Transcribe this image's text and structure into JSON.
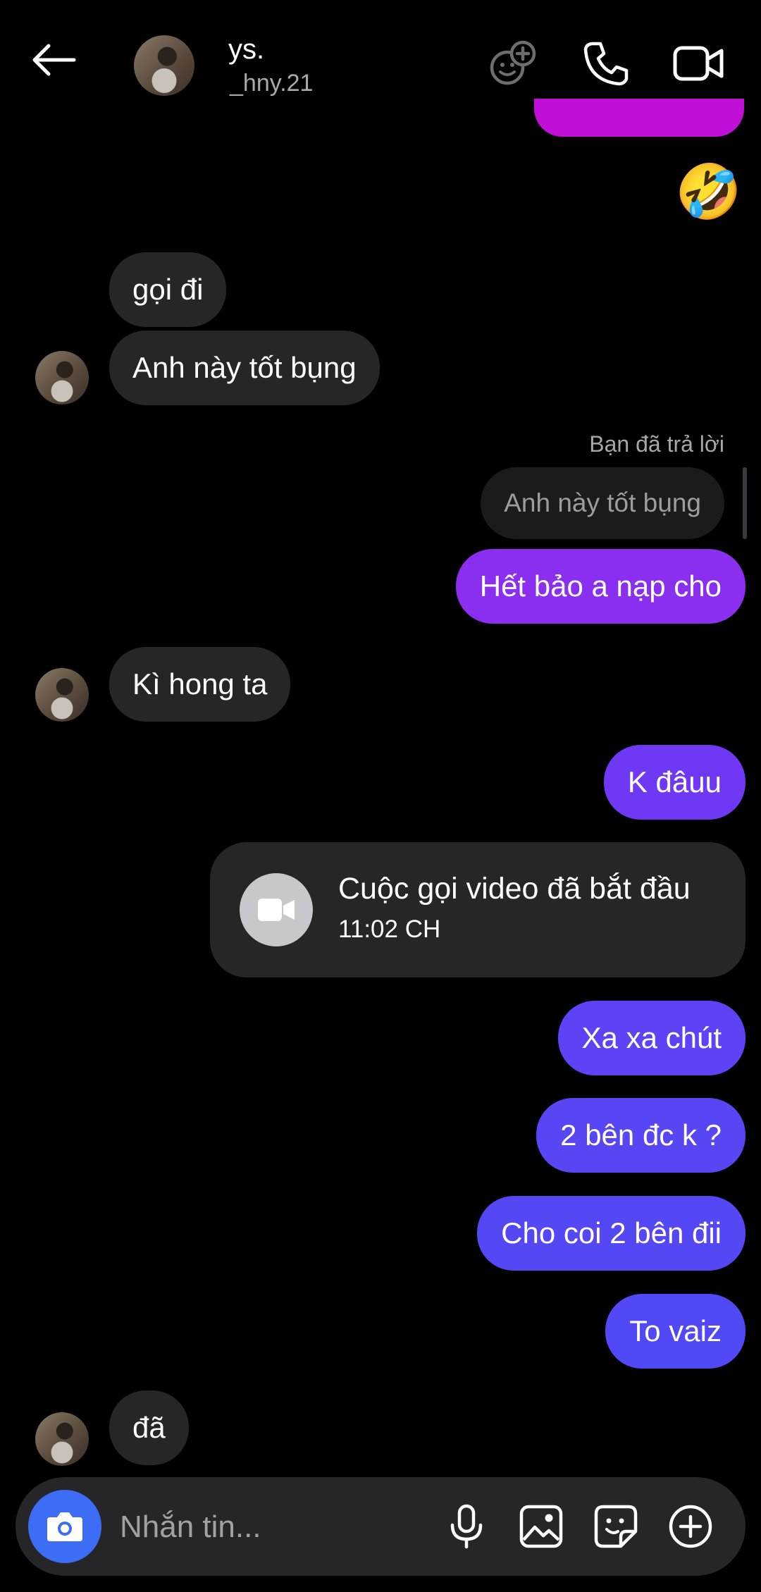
{
  "header": {
    "back_icon": "arrow-left-icon",
    "contact_name": "ys.",
    "contact_handle": "_hny.21",
    "actions": [
      "effects-icon",
      "phone-icon",
      "video-icon"
    ]
  },
  "messages": {
    "m1": "gọi đi",
    "m2": "Anh này tốt bụng",
    "reply_note": "Bạn đã trả lời",
    "reply_quote": "Anh này tốt bụng",
    "m3": "Hết bảo a nạp cho",
    "m4": "Kì hong ta",
    "m5": "K đâuu",
    "call": {
      "title": "Cuộc gọi video đã bắt đầu",
      "time": "11:02 CH"
    },
    "m6": "Xa xa chút",
    "m7": "2 bên đc k ?",
    "m8": "Cho coi 2 bên đii",
    "m9": "To vaiz",
    "m10": "đã",
    "reaction_emoji": "🤣"
  },
  "composer": {
    "placeholder": "Nhắn tin...",
    "icons": [
      "camera-icon",
      "microphone-icon",
      "gallery-icon",
      "sticker-icon",
      "plus-icon"
    ]
  },
  "colors": {
    "background": "#000000",
    "incoming_bubble": "#262628",
    "outgoing_magenta": "#c20fd8",
    "outgoing_purple": "#8a2ff0",
    "outgoing_violet": "#6a3bf6",
    "outgoing_indigo": "#5348f5",
    "camera_button": "#3d6cf5"
  }
}
